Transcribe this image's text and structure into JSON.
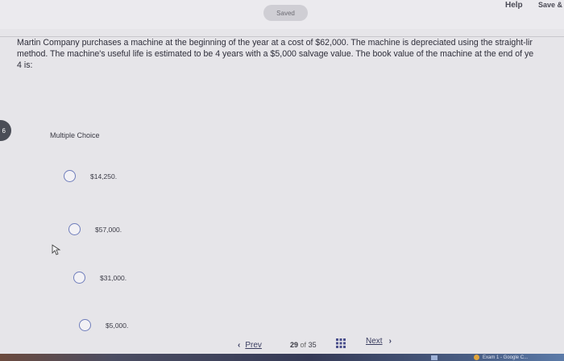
{
  "header": {
    "status": "Saved",
    "help_label": "Help",
    "save_exit_label": "Save &"
  },
  "question": {
    "number": "6",
    "line1": "Martin Company purchases a machine at the beginning of the year at a cost of $62,000. The machine is depreciated using the straight-lir",
    "line2": "method. The machine's useful life is estimated to be 4 years with a $5,000 salvage value. The book value of the machine at the end of ye",
    "line3": "4 is:"
  },
  "answer_type": "Multiple Choice",
  "options": [
    {
      "label": "$14,250."
    },
    {
      "label": "$57,000."
    },
    {
      "label": "$31,000."
    },
    {
      "label": "$5,000."
    }
  ],
  "navigation": {
    "prev_label": "Prev",
    "current_page": "29",
    "of_label": "of",
    "total_pages": "35",
    "next_label": "Next",
    "grid_icon": "grid-icon"
  },
  "taskbar": {
    "item_label": "Exam 1 - Google C..."
  },
  "colors": {
    "background": "#e6e5e9",
    "radio_border": "#6f7dbb",
    "nav_text": "#3a3d60",
    "question_badge": "#4a4d56"
  }
}
